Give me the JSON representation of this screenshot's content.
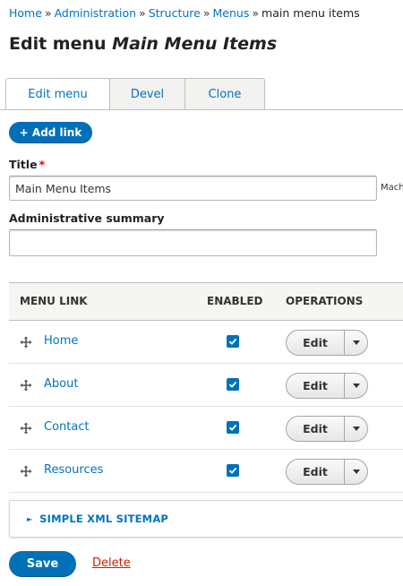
{
  "breadcrumb": {
    "items": [
      "Home",
      "Administration",
      "Structure",
      "Menus"
    ],
    "current": "main menu items",
    "separator": "»"
  },
  "page": {
    "title_prefix": "Edit menu",
    "title_menu_name": "Main Menu Items"
  },
  "tabs": [
    {
      "label": "Edit menu",
      "active": true
    },
    {
      "label": "Devel",
      "active": false
    },
    {
      "label": "Clone",
      "active": false
    }
  ],
  "actions": {
    "add_link": "+ Add link",
    "save": "Save",
    "delete": "Delete"
  },
  "form": {
    "title_label": "Title",
    "required_marker": "*",
    "title_value": "Main Menu Items",
    "machine_name_label": "Mach",
    "summary_label": "Administrative summary",
    "summary_value": ""
  },
  "table": {
    "headers": [
      "MENU LINK",
      "ENABLED",
      "OPERATIONS"
    ],
    "rows": [
      {
        "link": "Home",
        "enabled": true,
        "operation": "Edit"
      },
      {
        "link": "About",
        "enabled": true,
        "operation": "Edit"
      },
      {
        "link": "Contact",
        "enabled": true,
        "operation": "Edit"
      },
      {
        "link": "Resources",
        "enabled": true,
        "operation": "Edit"
      }
    ]
  },
  "sitemap": {
    "label": "SIMPLE XML SITEMAP",
    "toggle_glyph": "►"
  },
  "colors": {
    "link": "#0074bd",
    "primary": "#0071b8",
    "danger": "#c72100",
    "required": "#e00000"
  },
  "icons": {
    "drag": "drag-handle-icon",
    "checkbox": "checkmark-icon",
    "dropdown": "chevron-down-icon"
  }
}
